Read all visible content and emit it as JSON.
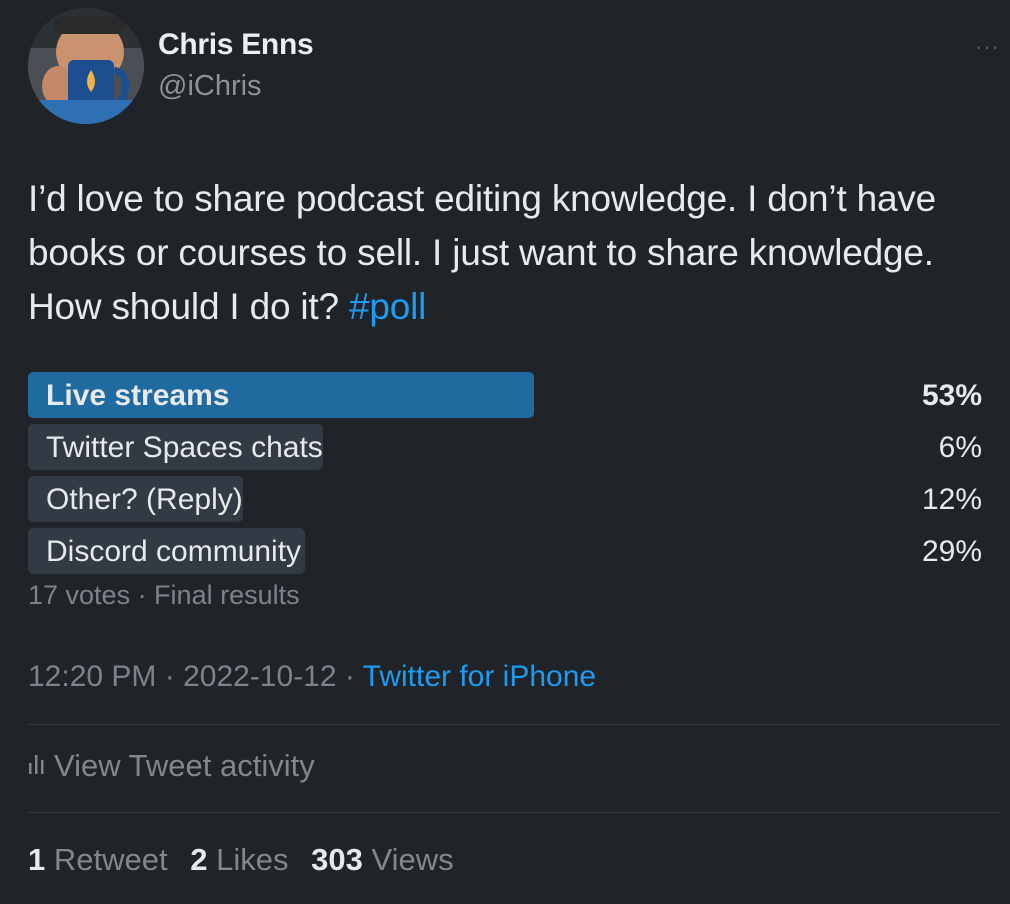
{
  "author": {
    "name": "Chris Enns",
    "handle": "@iChris",
    "more_icon": "ellipsis-icon"
  },
  "tweet": {
    "text_before_hashtag": "I’d love to share podcast editing knowledge. I don’t have books or courses to sell. I just want to share knowledge. How should I do it? ",
    "hashtag": "#poll"
  },
  "poll": {
    "options": [
      {
        "label": "Live streams",
        "percent_text": "53%",
        "percent": 53,
        "winner": true
      },
      {
        "label": "Twitter Spaces chats",
        "percent_text": "6%",
        "percent": 6,
        "winner": false
      },
      {
        "label": "Other? (Reply)",
        "percent_text": "12%",
        "percent": 12,
        "winner": false
      },
      {
        "label": "Discord community",
        "percent_text": "29%",
        "percent": 29,
        "winner": false
      }
    ],
    "meta": "17 votes · Final results"
  },
  "timestamp": {
    "time_date": "12:20 PM · 2022-10-12 · ",
    "source": "Twitter for iPhone"
  },
  "activity": {
    "label": "View Tweet activity",
    "icon": "bar-chart-icon"
  },
  "stats": {
    "retweets_count": "1",
    "retweets_label": "Retweet",
    "likes_count": "2",
    "likes_label": "Likes",
    "views_count": "303",
    "views_label": "Views"
  },
  "colors": {
    "background": "#202327",
    "accent": "#1d9bf0",
    "winner_bar": "#1f6a9e",
    "bar": "#323a44"
  }
}
